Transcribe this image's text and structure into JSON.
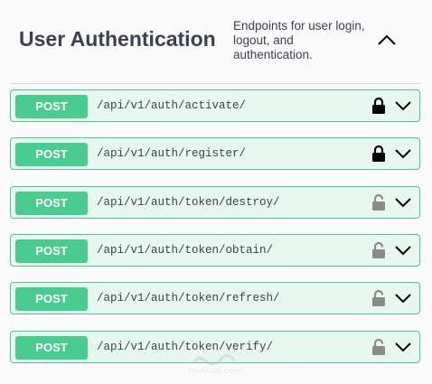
{
  "section": {
    "title": "User Authentication",
    "description": "Endpoints for user login, logout, and authentication."
  },
  "operations": [
    {
      "method": "POST",
      "path": "/api/v1/auth/activate/",
      "lock": "locked"
    },
    {
      "method": "POST",
      "path": "/api/v1/auth/register/",
      "lock": "locked"
    },
    {
      "method": "POST",
      "path": "/api/v1/auth/token/destroy/",
      "lock": "unlocked"
    },
    {
      "method": "POST",
      "path": "/api/v1/auth/token/obtain/",
      "lock": "unlocked"
    },
    {
      "method": "POST",
      "path": "/api/v1/auth/token/refresh/",
      "lock": "unlocked"
    },
    {
      "method": "POST",
      "path": "/api/v1/auth/token/verify/",
      "lock": "unlocked"
    }
  ],
  "watermark": {
    "text": "mostaql.com"
  },
  "colors": {
    "post": "#49cc90",
    "post_bg": "#e8f6f0",
    "text": "#3b4151",
    "lock_locked": "#000000",
    "lock_unlocked": "#8a8a8a"
  }
}
